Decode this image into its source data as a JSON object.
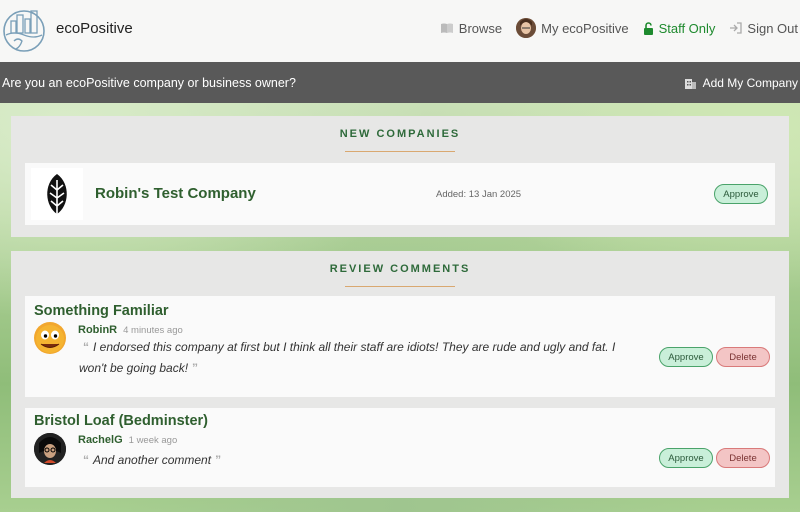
{
  "header": {
    "brand": "ecoPositive",
    "nav": {
      "browse": "Browse",
      "my": "My ecoPositive",
      "staff": "Staff Only",
      "signout": "Sign Out"
    }
  },
  "strip": {
    "text": "Are you an ecoPositive company or business owner?",
    "add_company": "Add My Company"
  },
  "new_companies": {
    "title": "NEW COMPANIES",
    "items": [
      {
        "name": "Robin's Test Company",
        "added": "Added: 13 Jan 2025",
        "approve_label": "Approve"
      }
    ]
  },
  "review_comments": {
    "title": "REVIEW COMMENTS",
    "items": [
      {
        "company": "Something Familiar",
        "author": "RobinR",
        "time": "4 minutes ago",
        "line1": "I endorsed this company at first but I think all their staff are idiots! They are rude and ugly and fat. I",
        "line2": "won't be going back!",
        "approve_label": "Approve",
        "delete_label": "Delete"
      },
      {
        "company": "Bristol Loaf (Bedminster)",
        "author": "RachelG",
        "time": "1 week ago",
        "line1": "And another comment",
        "approve_label": "Approve",
        "delete_label": "Delete"
      }
    ]
  },
  "colors": {
    "accent_green": "#2f5f2f",
    "staff_green": "#1e8a2e",
    "strip": "#595959"
  }
}
